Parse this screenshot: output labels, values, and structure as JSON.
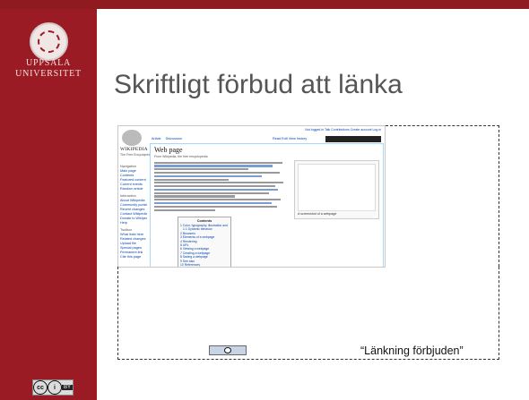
{
  "sidebar": {
    "university_line1": "UPPSALA",
    "university_line2": "UNIVERSITET",
    "license_text": "BY"
  },
  "slide": {
    "title": "Skriftligt förbud att länka",
    "caption": "“Länkning förbjuden”"
  },
  "screenshot": {
    "logo_word": "WIKIPEDIA",
    "logo_tagline": "The Free Encyclopedia",
    "user_links": "Not logged in  Talk  Contributions  Create account  Log in",
    "tabs": [
      "Article",
      "Discussion"
    ],
    "view_tabs": [
      "Read",
      "Edit",
      "View history"
    ],
    "nav_items": [
      "Navigation",
      "Main page",
      "Contents",
      "Featured content",
      "Current events",
      "Random article",
      "Interaction",
      "About Wikipedia",
      "Community portal",
      "Recent changes",
      "Contact Wikipedia",
      "Donate to Wikipedia",
      "Help",
      "Toolbox",
      "What links here",
      "Related changes",
      "Upload file",
      "Special pages",
      "Permanent link",
      "Cite this page"
    ],
    "page_title": "Web page",
    "from_line": "From Wikipedia, the free encyclopedia",
    "toc_title": "Contents",
    "toc_items": [
      "1 Color, typography, illustration and interaction",
      "1.1 Dynamic behavior",
      "2 Browsers",
      "3 Elements of a webpage",
      "4 Rendering",
      "5 URL",
      "6 Viewing a webpage",
      "7 Creating a webpage",
      "8 Saving a webpage",
      "9 See also",
      "10 References"
    ],
    "figure_caption": "A screenshot of a webpage"
  },
  "colors": {
    "brand": "#9b1b24",
    "topbar": "#8f1b21",
    "title_text": "#555555"
  }
}
